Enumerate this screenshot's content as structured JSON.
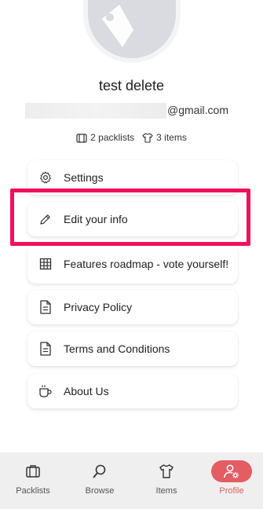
{
  "profile": {
    "name": "test delete",
    "email_domain": "@gmail.com",
    "packlists_count": "2 packlists",
    "items_count": "3 items"
  },
  "menu": [
    {
      "label": "Settings",
      "icon": "gear-icon"
    },
    {
      "label": "Edit your info",
      "icon": "pencil-icon"
    },
    {
      "label": "Features roadmap - vote yourself!",
      "icon": "grid-icon"
    },
    {
      "label": "Privacy Policy",
      "icon": "document-icon"
    },
    {
      "label": "Terms and Conditions",
      "icon": "document-icon"
    },
    {
      "label": "About Us",
      "icon": "coffee-cup-icon"
    }
  ],
  "tabs": [
    {
      "label": "Packlists",
      "icon": "suitcase-icon"
    },
    {
      "label": "Browse",
      "icon": "search-icon"
    },
    {
      "label": "Items",
      "icon": "tshirt-icon"
    },
    {
      "label": "Profile",
      "icon": "user-gear-icon",
      "active": true
    }
  ],
  "colors": {
    "accent": "#e35d63",
    "highlight_box": "#f2105d",
    "tabbar_bg": "#efefef",
    "avatar_bg": "#d9dbe0"
  }
}
